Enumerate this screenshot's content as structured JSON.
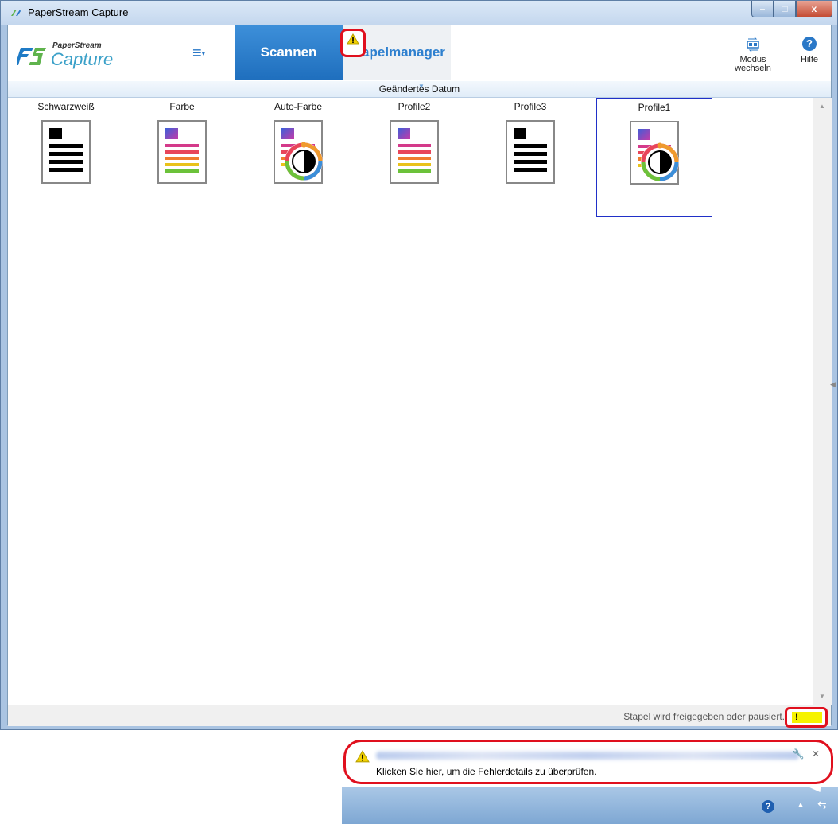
{
  "window": {
    "title": "PaperStream Capture",
    "controls": {
      "minimize": "–",
      "maximize": "□",
      "close": "x"
    }
  },
  "logo": {
    "line1": "PaperStream",
    "line2": "Capture"
  },
  "menu": {
    "icon": "≡"
  },
  "tabs": [
    {
      "label": "Scannen",
      "active": true
    },
    {
      "label": "Stapelmanager",
      "active": false
    }
  ],
  "toolbar": {
    "mode_label_1": "Modus",
    "mode_label_2": "wechseln",
    "help_label": "Hilfe"
  },
  "sort": {
    "label": "Geändertes Datum"
  },
  "profiles": [
    {
      "name": "Schwarzweiß",
      "icon": "bw-document-icon",
      "selected": false
    },
    {
      "name": "Farbe",
      "icon": "color-document-icon",
      "selected": false
    },
    {
      "name": "Auto-Farbe",
      "icon": "auto-color-document-icon",
      "selected": false
    },
    {
      "name": "Profile2",
      "icon": "color-document-icon",
      "selected": false
    },
    {
      "name": "Profile3",
      "icon": "bw-document-icon",
      "selected": false
    },
    {
      "name": "Profile1",
      "icon": "auto-color-document-icon",
      "selected": true
    }
  ],
  "status": {
    "text": "Stapel wird freigegeben oder pausiert.",
    "warn": "!"
  },
  "balloon": {
    "message": "Klicken Sie hier, um die Fehlerdetails zu überprüfen."
  },
  "colors": {
    "accent": "#1f6fbe",
    "warning": "#f6f300",
    "highlight_ring": "#e0101e"
  }
}
